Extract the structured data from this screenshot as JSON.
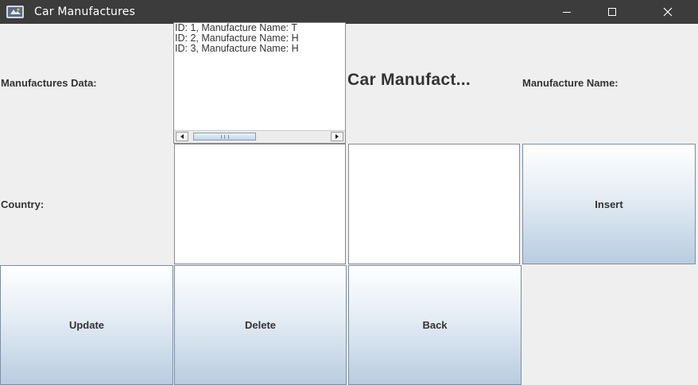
{
  "window": {
    "title": "Car Manufactures",
    "icon": "java-app-icon",
    "controls": {
      "minimize": "minimize-icon",
      "maximize": "maximize-icon",
      "close": "close-icon"
    }
  },
  "form": {
    "manufactures_label": "Manufactures Data:",
    "heading": "Car Manufact...",
    "manufacture_name_label": "Manufacture Name:",
    "country_label": "Country:",
    "list_items": [
      "ID: 1, Manufacture Name: T",
      "ID: 2, Manufacture Name: H",
      "ID: 3, Manufacture Name: H"
    ],
    "manufacture_name_value": "",
    "country_value": ""
  },
  "buttons": {
    "insert": "Insert",
    "update": "Update",
    "delete": "Delete",
    "back": "Back"
  },
  "colors": {
    "titlebar": "#3c3c3c",
    "window_bg": "#efefef",
    "button_top": "#ffffff",
    "button_bottom": "#b9cce0"
  }
}
